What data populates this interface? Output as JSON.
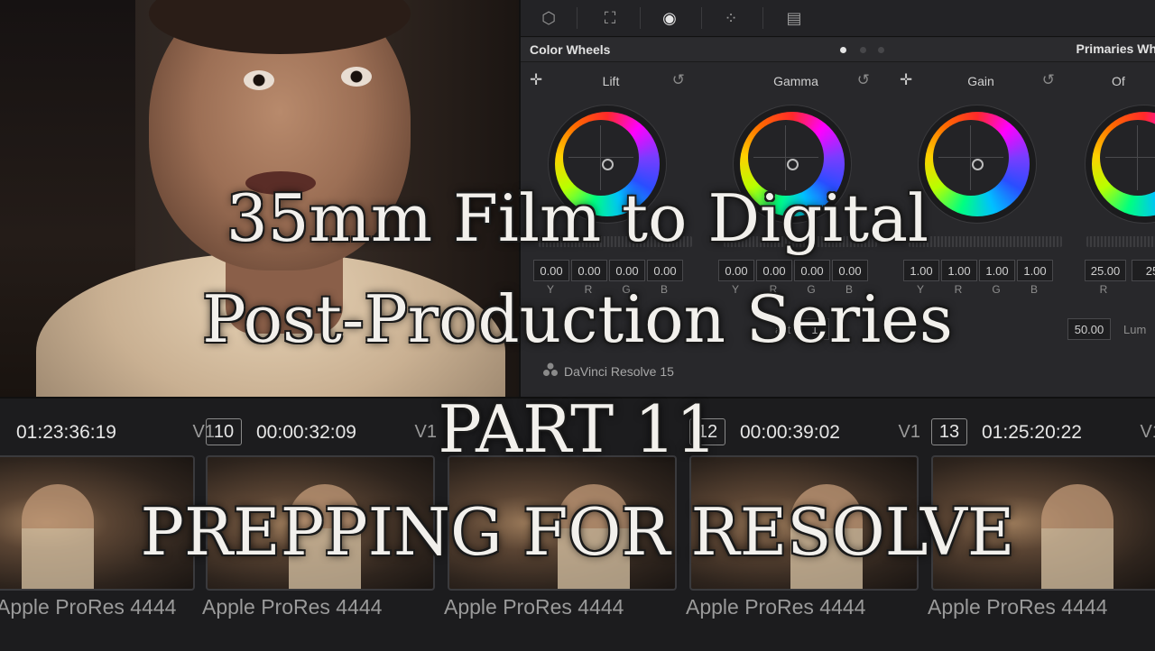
{
  "panel": {
    "title": "Color Wheels",
    "mode_title": "Primaries Wh",
    "toolbar_icons": [
      "3d-box-icon",
      "qualifier-grid-icon",
      "circle-window-icon",
      "dots-icon",
      "sizing-icon"
    ],
    "wheels": [
      {
        "label": "Lift",
        "values": [
          "0.00",
          "0.00",
          "0.00",
          "0.00"
        ],
        "channels": [
          "Y",
          "R",
          "G",
          "B"
        ]
      },
      {
        "label": "Gamma",
        "values": [
          "0.00",
          "0.00",
          "0.00",
          "0.00"
        ],
        "channels": [
          "Y",
          "R",
          "G",
          "B"
        ]
      },
      {
        "label": "Gain",
        "values": [
          "1.00",
          "1.00",
          "1.00",
          "1.00"
        ],
        "channels": [
          "Y",
          "R",
          "G",
          "B"
        ]
      },
      {
        "label": "Of",
        "values": [
          "25.00",
          "25"
        ],
        "channels": [
          "R",
          ""
        ]
      }
    ],
    "contrast_fragment": "ast",
    "contrast_value": "1",
    "pivot_value": "50.00",
    "lum_label": "Lum",
    "brand": "DaVinci Resolve 15"
  },
  "clips": [
    {
      "num": "",
      "tc": "01:23:36:19",
      "track": "V1",
      "codec": "Apple ProRes 4444"
    },
    {
      "num": "10",
      "tc": "00:00:32:09",
      "track": "V1",
      "codec": "Apple ProRes 4444"
    },
    {
      "num": "",
      "tc": "",
      "track": "",
      "codec": "Apple ProRes 4444"
    },
    {
      "num": "12",
      "tc": "00:00:39:02",
      "track": "V1",
      "codec": "Apple ProRes 4444"
    },
    {
      "num": "13",
      "tc": "01:25:20:22",
      "track": "V1",
      "codec": "Apple ProRes 4444"
    }
  ],
  "title": {
    "line1": "35mm Film to Digital",
    "line2": "Post-Production Series",
    "line3": "PART 11",
    "line4": "PREPPING FOR RESOLVE"
  }
}
